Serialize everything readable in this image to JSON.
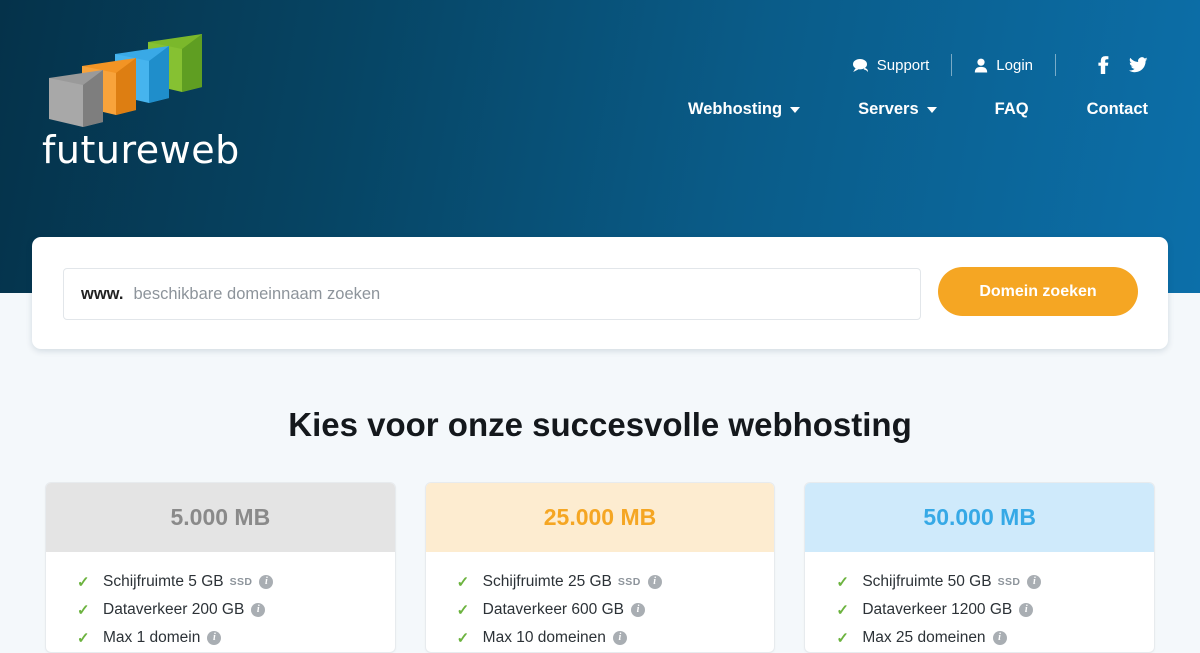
{
  "brand": {
    "name": "futureweb",
    "logo_colors": [
      "#8e8e8e",
      "#f39424",
      "#2b9ee0",
      "#6ab023"
    ],
    "header_gradient_from": "#05324a",
    "header_gradient_to": "#0c6fa9"
  },
  "topbar": {
    "support_label": "Support",
    "support_icon": "comment-icon",
    "login_label": "Login",
    "login_icon": "user-icon",
    "facebook_icon": "facebook-icon",
    "facebook_glyph": "f",
    "twitter_icon": "twitter-icon"
  },
  "nav": {
    "items": [
      {
        "label": "Webhosting",
        "has_caret": true
      },
      {
        "label": "Servers",
        "has_caret": true
      },
      {
        "label": "FAQ",
        "has_caret": false
      },
      {
        "label": "Contact",
        "has_caret": false
      }
    ]
  },
  "search": {
    "prefix": "www.",
    "placeholder": "beschikbare domeinnaam zoeken",
    "value": "",
    "button_label": "Domein zoeken",
    "button_color": "#f5a623"
  },
  "main": {
    "heading": "Kies voor onze succesvolle webhosting"
  },
  "plans": [
    {
      "title": "5.000 MB",
      "theme": "grey",
      "header_bg": "#e4e4e4",
      "title_color": "#8a8a8a",
      "features": [
        {
          "label": "Schijfruimte 5 GB",
          "tag": "SSD",
          "info": true
        },
        {
          "label": "Dataverkeer 200 GB",
          "tag": "",
          "info": true
        },
        {
          "label": "Max 1 domein",
          "tag": "",
          "info": true
        }
      ]
    },
    {
      "title": "25.000 MB",
      "theme": "amber",
      "header_bg": "#fdecd0",
      "title_color": "#f5a623",
      "features": [
        {
          "label": "Schijfruimte 25 GB",
          "tag": "SSD",
          "info": true
        },
        {
          "label": "Dataverkeer 600 GB",
          "tag": "",
          "info": true
        },
        {
          "label": "Max 10 domeinen",
          "tag": "",
          "info": true
        }
      ]
    },
    {
      "title": "50.000 MB",
      "theme": "blue",
      "header_bg": "#cfeafb",
      "title_color": "#36a9e6",
      "features": [
        {
          "label": "Schijfruimte 50 GB",
          "tag": "SSD",
          "info": true
        },
        {
          "label": "Dataverkeer 1200 GB",
          "tag": "",
          "info": true
        },
        {
          "label": "Max 25 domeinen",
          "tag": "",
          "info": true
        }
      ]
    }
  ]
}
